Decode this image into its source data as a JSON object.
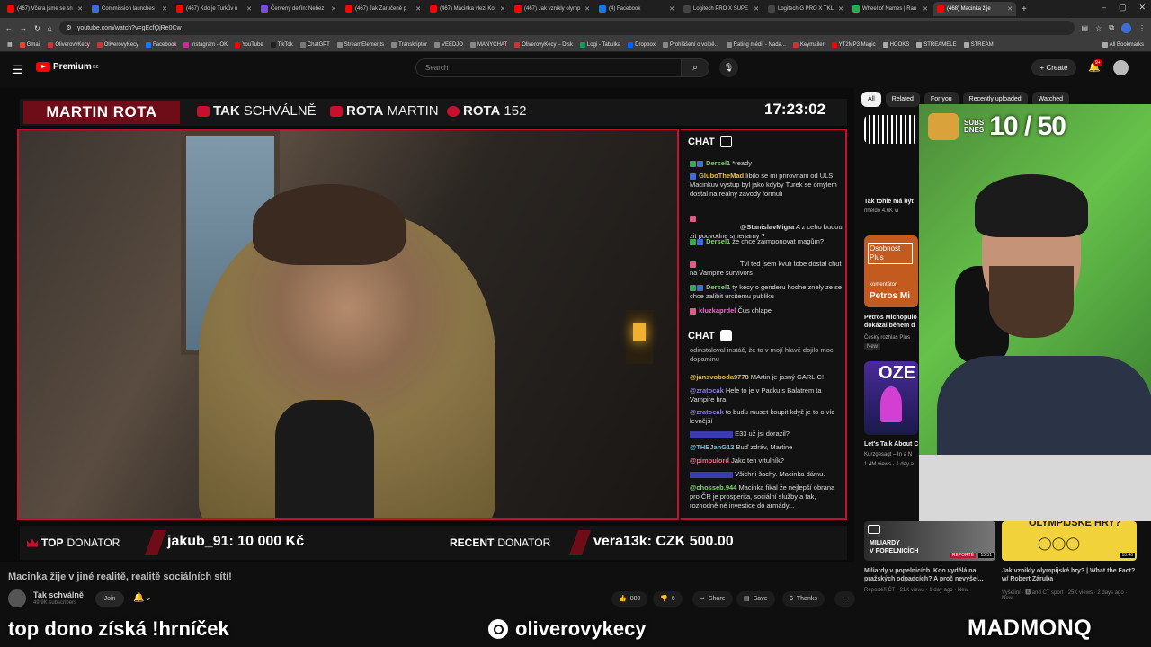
{
  "browser": {
    "tabs": [
      {
        "label": "(467) Včera jsme se sn",
        "color": "#ff0000"
      },
      {
        "label": "Commission launches",
        "color": "#3b6fd6"
      },
      {
        "label": "(467) Kdo je Turkův n",
        "color": "#ff0000"
      },
      {
        "label": "Červený delfín: Nebez",
        "color": "#7b4dd6"
      },
      {
        "label": "(467) Jak Zaručeně p",
        "color": "#ff0000"
      },
      {
        "label": "(467) Macinka vlezl Ko",
        "color": "#ff0000"
      },
      {
        "label": "(467) Jak vznikly olymp",
        "color": "#ff0000"
      },
      {
        "label": "(4) Facebook",
        "color": "#1877f2"
      },
      {
        "label": "Logitech PRO X SUPE",
        "color": "#444444"
      },
      {
        "label": "Logitech G PRO X TKL",
        "color": "#444444"
      },
      {
        "label": "Wheel of Names | Ran",
        "color": "#2fa84f"
      },
      {
        "label": "(468) Macinka žije",
        "color": "#ff0000"
      }
    ],
    "url": "youtube.com/watch?v=gEcfQjRe0Cw",
    "bookmarks": [
      "Gmail",
      "OliverovyKecy",
      "OliverovyKecy",
      "Facebook",
      "Instagram - OK",
      "YouTube",
      "TikTok",
      "ChatGPT",
      "StreamElements",
      "Transkriptor",
      "VEEDJO",
      "MANYCHAT",
      "OliverovyKecy – Disk",
      "Logi - Tabulka",
      "Dropbox",
      "Prohlášení o volbě...",
      "Rating médií - Nada...",
      "Keymailer",
      "YT2MP3 Magic",
      "HOOKS",
      "STREAMELE",
      "STREAM"
    ],
    "all_bookmarks": "All Bookmarks"
  },
  "youtube": {
    "logo": "Premium",
    "region": "CZ",
    "search_placeholder": "Search",
    "create": "Create",
    "notif_count": "9+",
    "chips": [
      "All",
      "Related",
      "For you",
      "Recently uploaded",
      "Watched"
    ]
  },
  "stream": {
    "name": "MARTIN ROTA",
    "socials": [
      {
        "bold": "TAK",
        "rest": "SCHVÁLNĚ"
      },
      {
        "bold": "ROTA",
        "rest": "MARTIN"
      },
      {
        "bold": "ROTA",
        "rest": "152"
      }
    ],
    "clock": "17:23:02",
    "chat_title": "CHAT",
    "twitch_chat": [
      {
        "user": "Dersel1",
        "text": "*ready",
        "color": "#7dd36a"
      },
      {
        "user": "GluboTheMad",
        "text": "libilo se mi prirovnani od ULS, Macinkuv vystup byl jako kdyby Turek se omylem dostal na realny zavody formuli",
        "color": "#e8c33a"
      },
      {
        "user": "@StanislavMigra",
        "text": "A z ceho budou zit podvodne smenarny ?",
        "color": "#dddddd"
      },
      {
        "user": "Dersel1",
        "text": "že chce zaimponovat magům?",
        "color": "#7dd36a"
      },
      {
        "user": "",
        "text": "Tvl ted jsem kvuli tobe dostal chut na Vampire survivors",
        "color": "#dddddd"
      },
      {
        "user": "Dersel1",
        "text": "ty kecy o genderu hodne znely ze se chce zalibit urcitemu publiku",
        "color": "#7dd36a"
      },
      {
        "user": "kluzkaprdel",
        "text": "Čus chlape",
        "color": "#e86ad0"
      }
    ],
    "yt_chat": [
      {
        "user": "",
        "text": "odinstaloval instáč, že to v mojí hlavě dojilo moc dopaminu",
        "color": "#dddddd"
      },
      {
        "user": "@jansvoboda9778",
        "text": "MArtin je jasný GARLIC!",
        "color": "#e8c33a"
      },
      {
        "user": "@zratocak",
        "text": "Hele to je v Packu s Balatrem ta Vampire hra",
        "color": "#8a7ae0"
      },
      {
        "user": "@zratocak",
        "text": "to budu muset koupit když je to o víc levnější",
        "color": "#8a7ae0"
      },
      {
        "user": "",
        "text": "E33 už jsi dorazil?",
        "color": "#dddddd"
      },
      {
        "user": "@THEJanG12",
        "text": "Buď zdráv, Martine",
        "color": "#6ac0e8"
      },
      {
        "user": "@pimpulord",
        "text": "Jako ten vrtulník?",
        "color": "#e86a8a"
      },
      {
        "user": "",
        "text": "Všichni šachy. Macinka dámu.",
        "color": "#dddddd"
      },
      {
        "user": "@chosseb.944",
        "text": "Macinka fikal že nejlepší obrana pro ČR je prosperita, sociální služby a tak, rozhodně né investice do armády...",
        "color": "#7dd36a"
      }
    ],
    "top_donator_label_bold": "TOP",
    "top_donator_label": "DONATOR",
    "top_donator_value": "jakub_91: 10 000 Kč",
    "recent_donator_label_bold": "RECENT",
    "recent_donator_label": "DONATOR",
    "recent_donator_value": "vera13k: CZK 500.00"
  },
  "facecam": {
    "subs_label_1": "SUBS",
    "subs_label_2": "DNES",
    "subs_count": "10 / 50"
  },
  "related": [
    {
      "title": "Tak tohle má být",
      "meta1": "rlheldo",
      "meta2": "4.6K vi"
    },
    {
      "title": "Petros Michopulo dokázal během d",
      "meta1": "Český rozhlas Plus",
      "meta2": "New",
      "thumb_text_1": "Osobnost Plus",
      "thumb_text_2": "komentátor",
      "thumb_text_3": "Petros Mi"
    },
    {
      "title": "Let's Talk About C",
      "meta1": "Kurzgesagt – In a N",
      "meta2": "1.4M views · 1 day a",
      "thumb_text_1": "OZE"
    }
  ],
  "bottom_related": [
    {
      "title": "Miliardy v popelnicích. Kdo vydělá na pražských odpadcích? A proč nevyšel...",
      "meta": "Reportéři ČT · 21K views · 1 day ago · New",
      "badge": "REPORTÉ",
      "duration": "15:51",
      "caption_1": "MILIARDY",
      "caption_2": "V POPELNICÍCH"
    },
    {
      "title": "Jak vznikly olympijské hry? | What the Fact? w/ Robert Záruba",
      "meta": "Vyšeliní · 🅰 and ČT sport · 25K views · 2 days ago · New",
      "duration": "10:46",
      "caption_1": "OLYMPIJSKÉ HRY?"
    }
  ],
  "video": {
    "title": "Macinka žije v jiné realitě, realitě sociálních sítí!",
    "channel": "Tak schválně",
    "subs": "49.9K subscribers",
    "join": "Join",
    "likes": "889",
    "dislikes": "6",
    "share": "Share",
    "save": "Save",
    "thanks": "Thanks"
  },
  "overlay": {
    "left": "top dono získá !hrníček",
    "center": "oliverovykecy",
    "right": "MADMONQ"
  }
}
